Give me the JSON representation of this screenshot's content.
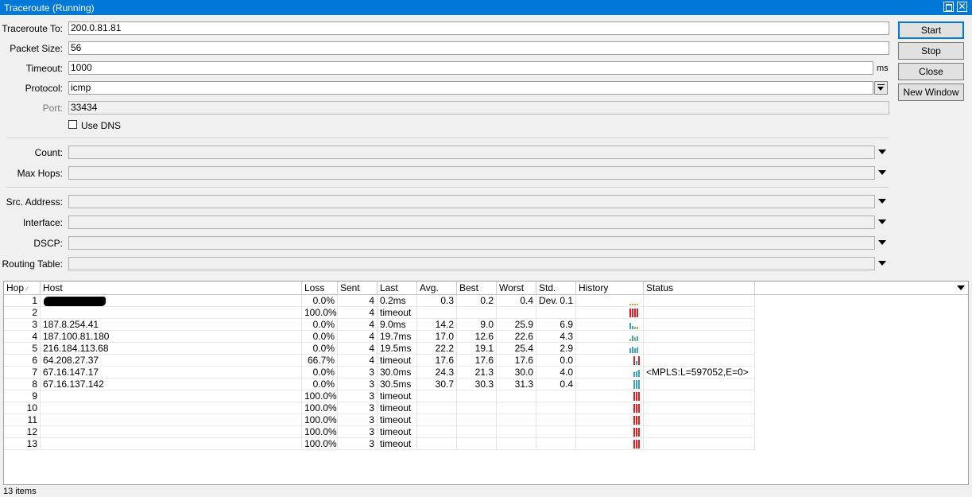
{
  "window": {
    "title": "Traceroute (Running)"
  },
  "form": {
    "traceroute_to_label": "Traceroute To:",
    "traceroute_to_value": "200.0.81.81",
    "packet_size_label": "Packet Size:",
    "packet_size_value": "56",
    "timeout_label": "Timeout:",
    "timeout_value": "1000",
    "timeout_unit": "ms",
    "protocol_label": "Protocol:",
    "protocol_value": "icmp",
    "port_label": "Port:",
    "port_value": "33434",
    "use_dns_label": "Use DNS",
    "count_label": "Count:",
    "max_hops_label": "Max Hops:",
    "src_address_label": "Src. Address:",
    "interface_label": "Interface:",
    "dscp_label": "DSCP:",
    "routing_table_label": "Routing Table:"
  },
  "buttons": {
    "start": "Start",
    "stop": "Stop",
    "close": "Close",
    "new_window": "New Window"
  },
  "table": {
    "columns": [
      "Hop",
      "Host",
      "Loss",
      "Sent",
      "Last",
      "Avg.",
      "Best",
      "Worst",
      "Std. Dev.",
      "History",
      "Status"
    ],
    "rows": [
      {
        "hop": "1",
        "host": "",
        "loss": "0.0%",
        "sent": "4",
        "last": "0.2ms",
        "avg": "0.3",
        "best": "0.2",
        "worst": "0.4",
        "std": "0.1",
        "status": ""
      },
      {
        "hop": "2",
        "host": "",
        "loss": "100.0%",
        "sent": "4",
        "last": "timeout",
        "avg": "",
        "best": "",
        "worst": "",
        "std": "",
        "status": ""
      },
      {
        "hop": "3",
        "host": "187.8.254.41",
        "loss": "0.0%",
        "sent": "4",
        "last": "9.0ms",
        "avg": "14.2",
        "best": "9.0",
        "worst": "25.9",
        "std": "6.9",
        "status": ""
      },
      {
        "hop": "4",
        "host": "187.100.81.180",
        "loss": "0.0%",
        "sent": "4",
        "last": "19.7ms",
        "avg": "17.0",
        "best": "12.6",
        "worst": "22.6",
        "std": "4.3",
        "status": ""
      },
      {
        "hop": "5",
        "host": "216.184.113.68",
        "loss": "0.0%",
        "sent": "4",
        "last": "19.5ms",
        "avg": "22.2",
        "best": "19.1",
        "worst": "25.4",
        "std": "2.9",
        "status": ""
      },
      {
        "hop": "6",
        "host": "64.208.27.37",
        "loss": "66.7%",
        "sent": "4",
        "last": "timeout",
        "avg": "17.6",
        "best": "17.6",
        "worst": "17.6",
        "std": "0.0",
        "status": ""
      },
      {
        "hop": "7",
        "host": "67.16.147.17",
        "loss": "0.0%",
        "sent": "3",
        "last": "30.0ms",
        "avg": "24.3",
        "best": "21.3",
        "worst": "30.0",
        "std": "4.0",
        "status": "<MPLS:L=597052,E=0>"
      },
      {
        "hop": "8",
        "host": "67.16.137.142",
        "loss": "0.0%",
        "sent": "3",
        "last": "30.5ms",
        "avg": "30.7",
        "best": "30.3",
        "worst": "31.3",
        "std": "0.4",
        "status": ""
      },
      {
        "hop": "9",
        "host": "",
        "loss": "100.0%",
        "sent": "3",
        "last": "timeout",
        "avg": "",
        "best": "",
        "worst": "",
        "std": "",
        "status": ""
      },
      {
        "hop": "10",
        "host": "",
        "loss": "100.0%",
        "sent": "3",
        "last": "timeout",
        "avg": "",
        "best": "",
        "worst": "",
        "std": "",
        "status": ""
      },
      {
        "hop": "11",
        "host": "",
        "loss": "100.0%",
        "sent": "3",
        "last": "timeout",
        "avg": "",
        "best": "",
        "worst": "",
        "std": "",
        "status": ""
      },
      {
        "hop": "12",
        "host": "",
        "loss": "100.0%",
        "sent": "3",
        "last": "timeout",
        "avg": "",
        "best": "",
        "worst": "",
        "std": "",
        "status": ""
      },
      {
        "hop": "13",
        "host": "",
        "loss": "100.0%",
        "sent": "3",
        "last": "timeout",
        "avg": "",
        "best": "",
        "worst": "",
        "std": "",
        "status": ""
      }
    ],
    "history_colors": {
      "ok": "#3aa6c4",
      "ok_low": "#8cbf5a",
      "timeout": "#e02020",
      "pending": "#d0a040"
    }
  },
  "status_bar": {
    "items_count": "13 items"
  }
}
